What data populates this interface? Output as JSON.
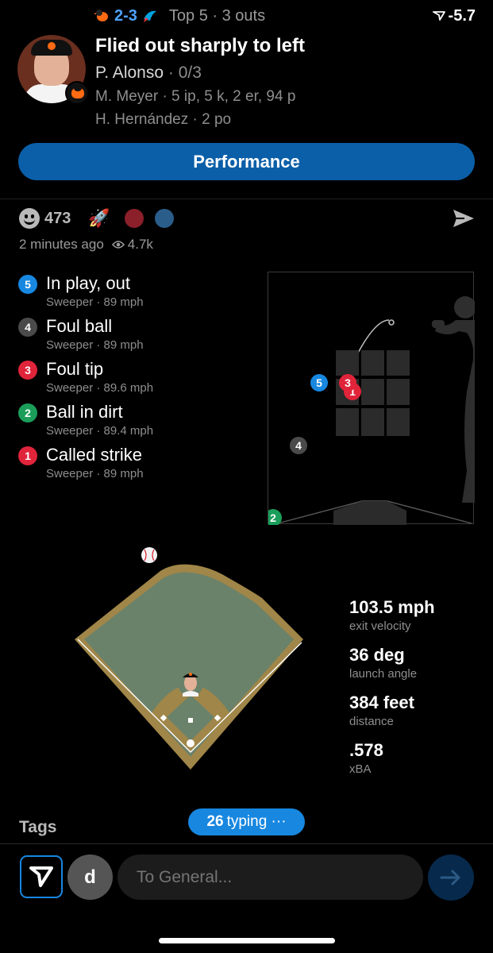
{
  "header": {
    "score": "2-3",
    "inning": "Top 5 · 3 outs",
    "wpa": "-5.7"
  },
  "play": {
    "title": "Flied out sharply to left",
    "batter": "P. Alonso",
    "batter_stats": "· 0/3",
    "pitcher_line": "M. Meyer · 5 ip, 5 k, 2 er, 94 p",
    "fielder_line": "H. Hernández · 2 po"
  },
  "performance_button": "Performance",
  "reactions": {
    "smile_count": "473",
    "time_ago": "2 minutes ago",
    "views": "4.7k"
  },
  "pitches": [
    {
      "num": "5",
      "color": "#1787e0",
      "result": "In play, out",
      "detail": "Sweeper ·  89 mph"
    },
    {
      "num": "4",
      "color": "#4a4a4a",
      "result": "Foul ball",
      "detail": "Sweeper ·  89 mph"
    },
    {
      "num": "3",
      "color": "#e0243a",
      "result": "Foul tip",
      "detail": "Sweeper ·  89.6 mph"
    },
    {
      "num": "2",
      "color": "#1a9e5a",
      "result": "Ball in dirt",
      "detail": "Sweeper ·  89.4 mph"
    },
    {
      "num": "1",
      "color": "#e0243a",
      "result": "Called strike",
      "detail": "Sweeper ·  89 mph"
    }
  ],
  "zone_markers": [
    "5",
    "3",
    "1",
    "4",
    "2"
  ],
  "hit_stats": [
    {
      "value": "103.5 mph",
      "label": "exit velocity"
    },
    {
      "value": "36 deg",
      "label": "launch angle"
    },
    {
      "value": "384 feet",
      "label": "distance"
    },
    {
      "value": ".578",
      "label": "xBA"
    }
  ],
  "tags_label": "Tags",
  "typing": {
    "count": "26",
    "text": "typing ···"
  },
  "compose": {
    "avatar_letter": "d",
    "placeholder": "To General..."
  },
  "colors": {
    "accent": "#1787e0",
    "orioles_orange": "#ff6a13",
    "field_dirt": "#a08648",
    "field_grass": "#6b826a"
  }
}
